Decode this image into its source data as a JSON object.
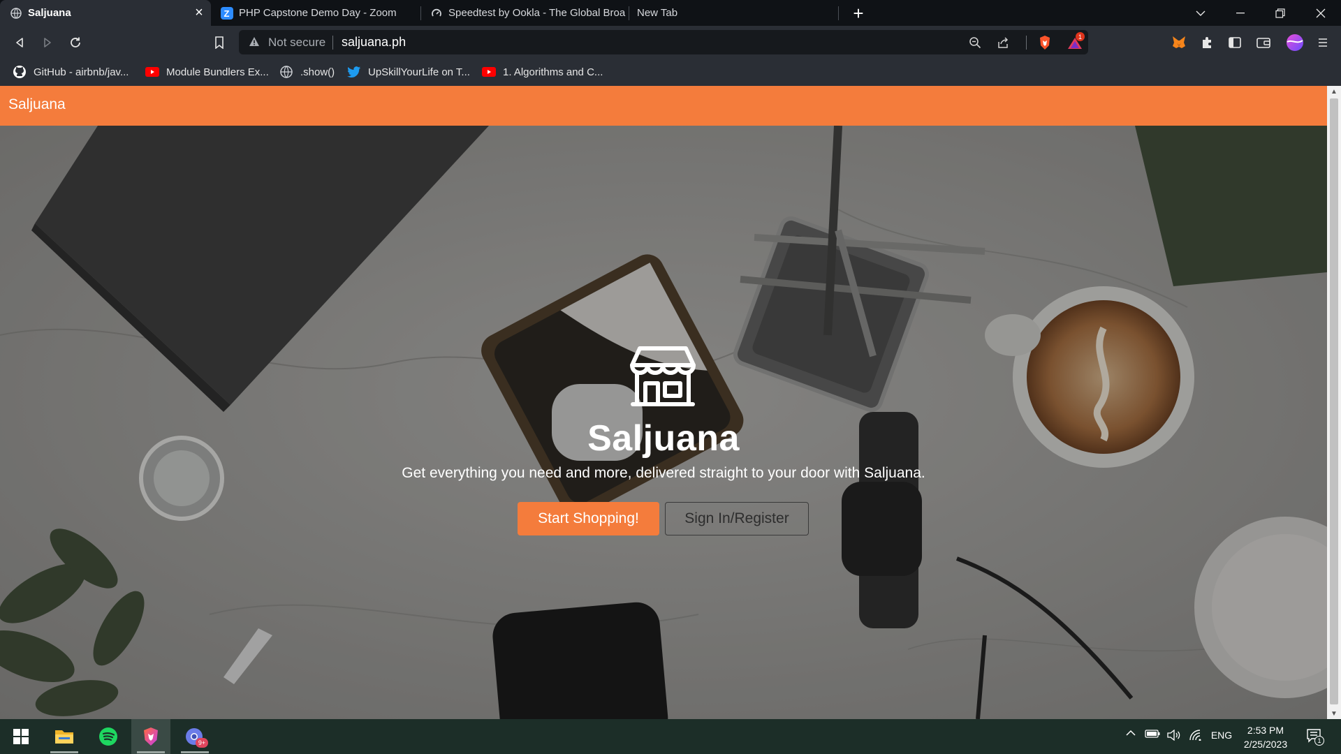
{
  "browser": {
    "tabs": [
      {
        "title": "Saljuana",
        "active": true
      },
      {
        "title": "PHP Capstone Demo Day - Zoom",
        "active": false
      },
      {
        "title": "Speedtest by Ookla - The Global Broa",
        "active": false
      },
      {
        "title": "New Tab",
        "active": false
      }
    ],
    "address_bar": {
      "security_label": "Not secure",
      "url": "saljuana.ph"
    },
    "brave_rewards_badge": "1",
    "bookmarks": [
      {
        "label": "GitHub - airbnb/jav...",
        "icon": "github-icon"
      },
      {
        "label": "Module Bundlers Ex...",
        "icon": "youtube-icon"
      },
      {
        "label": ".show()",
        "icon": "globe-icon"
      },
      {
        "label": "UpSkillYourLife on T...",
        "icon": "twitter-icon"
      },
      {
        "label": "1. Algorithms and C...",
        "icon": "youtube-icon"
      }
    ]
  },
  "page": {
    "navbar": {
      "brand": "Saljuana"
    },
    "hero": {
      "icon": "store-icon",
      "title": "Saljuana",
      "subtitle": "Get everything you need and more, delivered straight to your door with Saljuana.",
      "primary_button": "Start Shopping!",
      "secondary_button": "Sign In/Register"
    }
  },
  "taskbar": {
    "apps": [
      "windows-start",
      "file-explorer",
      "spotify",
      "brave-browser",
      "chrome-canary"
    ],
    "chrome_badge": "9+",
    "language": "ENG",
    "time": "2:53 PM",
    "date": "2/25/2023",
    "notification_count": "1"
  },
  "colors": {
    "accent": "#f47c3c",
    "tab_strip": "#0f1216",
    "toolbar": "#2a2e35",
    "taskbar": "#1c2e28"
  }
}
